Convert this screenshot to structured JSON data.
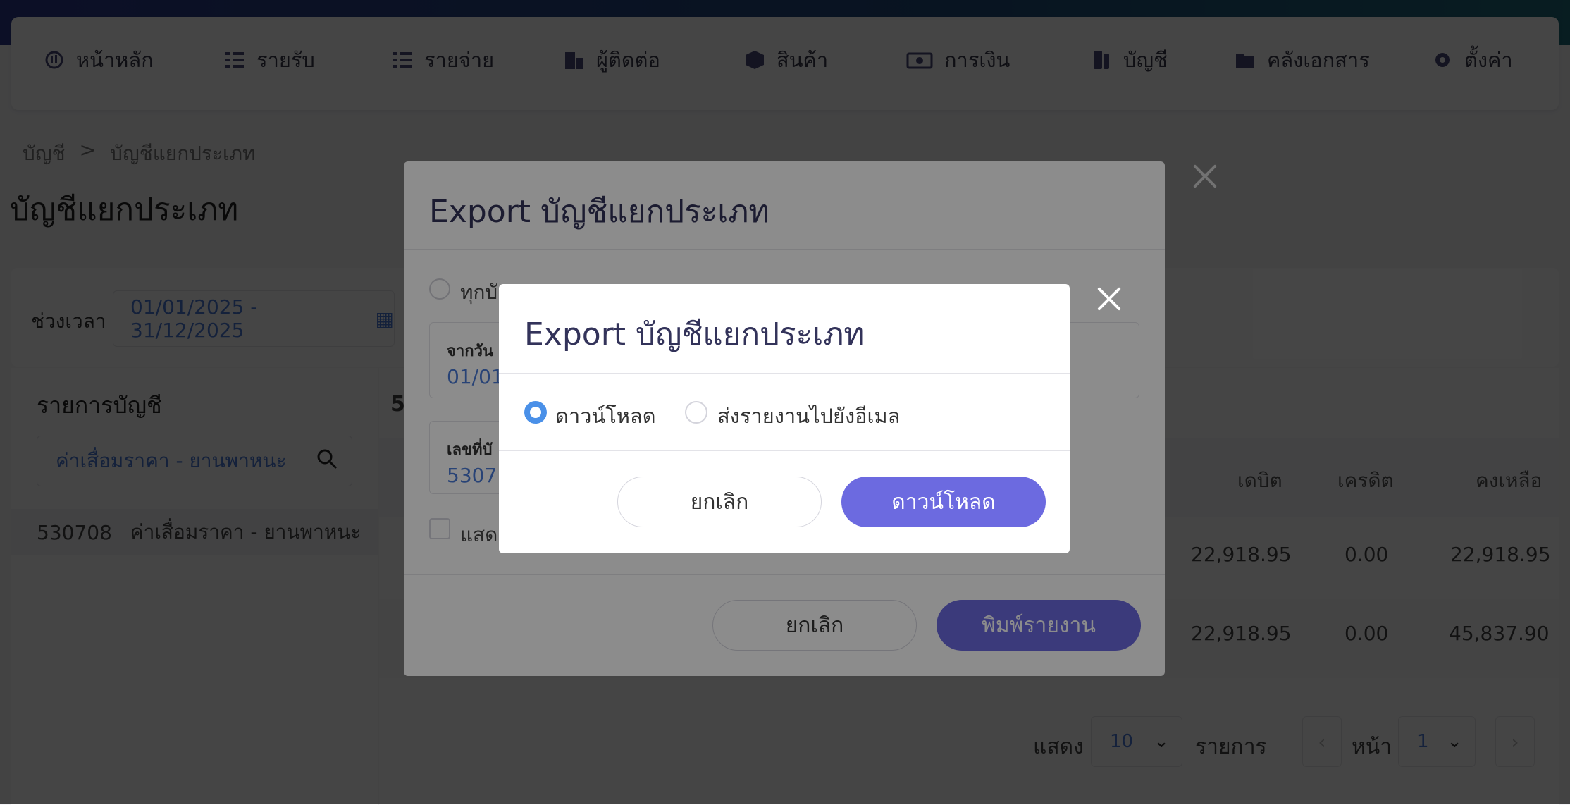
{
  "nav": {
    "items": [
      {
        "label": "หน้าหลัก",
        "icon": "dashboard-icon"
      },
      {
        "label": "รายรับ",
        "icon": "income-list-icon"
      },
      {
        "label": "รายจ่าย",
        "icon": "expense-list-icon"
      },
      {
        "label": "ผู้ติดต่อ",
        "icon": "contacts-icon"
      },
      {
        "label": "สินค้า",
        "icon": "box-icon"
      },
      {
        "label": "การเงิน",
        "icon": "money-icon"
      },
      {
        "label": "บัญชี",
        "icon": "ledger-icon"
      },
      {
        "label": "คลังเอกสาร",
        "icon": "folder-icon"
      },
      {
        "label": "ตั้งค่า",
        "icon": "gear-icon"
      }
    ]
  },
  "breadcrumb": {
    "root": "บัญชี",
    "sep": ">",
    "current": "บัญชีแยกประเภท"
  },
  "page": {
    "title": "บัญชีแยกประเภท"
  },
  "filter": {
    "period_label": "ช่วงเวลา",
    "period_value": "01/01/2025 - 31/12/2025"
  },
  "left_panel": {
    "title": "รายการบัญชี",
    "search_value": "ค่าเสื่อมราคา - ยานพาหนะ",
    "accounts": [
      {
        "code": "530708",
        "name": "ค่าเสื่อมราคา - ยานพาหนะ"
      }
    ]
  },
  "table": {
    "partial_code": "5",
    "headers": {
      "debit": "เดบิต",
      "credit": "เครดิต",
      "balance": "คงเหลือ"
    },
    "rows": [
      {
        "debit": "22,918.95",
        "credit": "0.00",
        "balance": "22,918.95"
      },
      {
        "debit": "22,918.95",
        "credit": "0.00",
        "balance": "45,837.90"
      }
    ]
  },
  "pager": {
    "show_label": "แสดง",
    "page_size": "10",
    "items_label": "รายการ",
    "page_label": "หน้า",
    "page": "1"
  },
  "export_dialog_back": {
    "title": "Export บัญชีแยกประเภท",
    "radio_partial": "ทุกบั",
    "from_date_label": "จากวัน",
    "from_date_value": "01/01",
    "account_no_label": "เลขที่บั",
    "account_no_value": "5307",
    "checkbox_partial": "แสด",
    "cancel_label": "ยกเลิก",
    "print_label": "พิมพ์รายงาน"
  },
  "export_dialog": {
    "title": "Export บัญชีแยกประเภท",
    "options": [
      {
        "label": "ดาวน์โหลด",
        "selected": true
      },
      {
        "label": "ส่งรายงานไปยังอีเมล",
        "selected": false
      }
    ],
    "cancel_label": "ยกเลิก",
    "download_label": "ดาวน์โหลด"
  },
  "colors": {
    "accent": "#6c6ae0",
    "link": "#4a7ad8",
    "radio": "#4a90e8"
  }
}
